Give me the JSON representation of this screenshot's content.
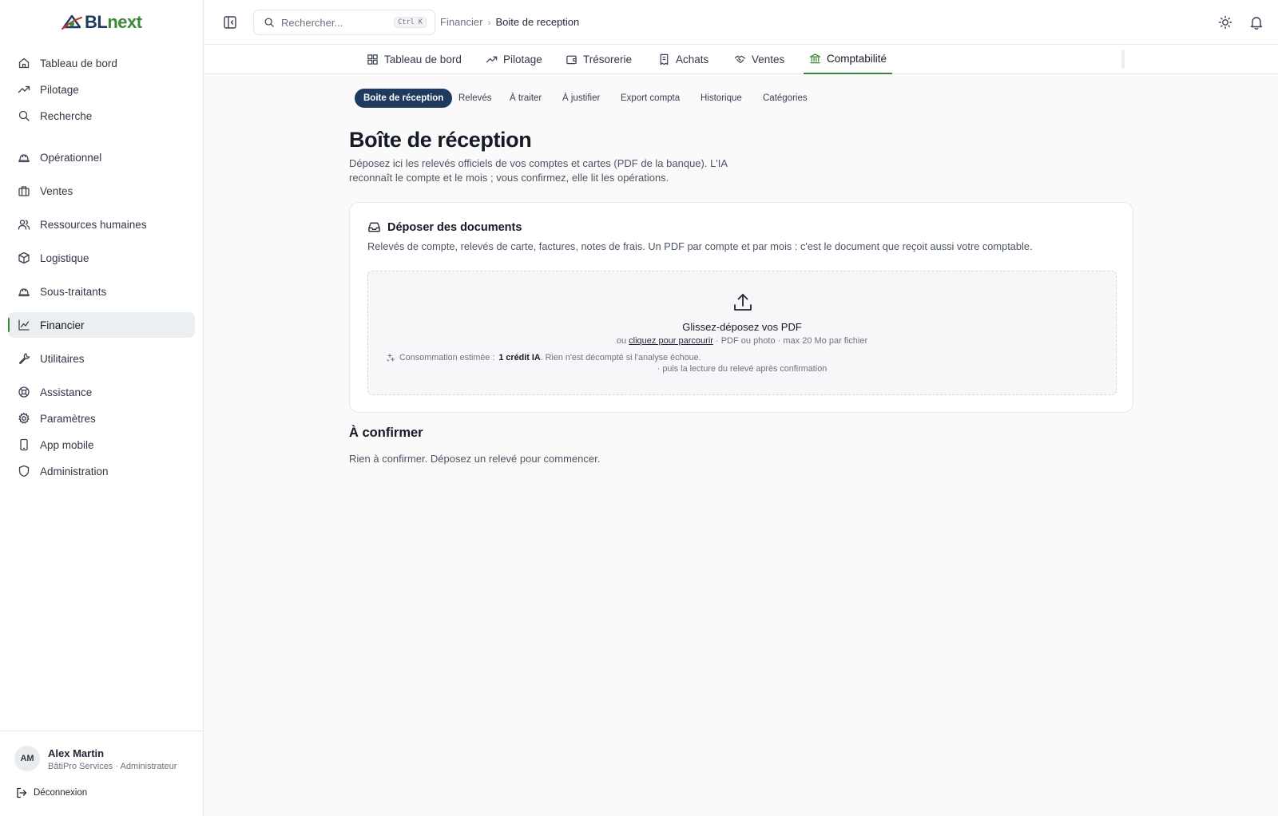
{
  "app": {
    "logo_prefix": "BL",
    "logo_suffix": "next",
    "colors": {
      "navy": "#1f3a5f",
      "green": "#3a8a3a"
    }
  },
  "sidebar": {
    "items": [
      {
        "label": "Tableau de bord",
        "icon": "home-icon"
      },
      {
        "label": "Pilotage",
        "icon": "trend-up-icon"
      },
      {
        "label": "Recherche",
        "icon": "search-icon"
      },
      {
        "label": "Opérationnel",
        "icon": "hard-hat-icon"
      },
      {
        "label": "Ventes",
        "icon": "briefcase-icon"
      },
      {
        "label": "Ressources humaines",
        "icon": "users-icon"
      },
      {
        "label": "Logistique",
        "icon": "box-icon"
      },
      {
        "label": "Sous-traitants",
        "icon": "hard-hat-icon"
      },
      {
        "label": "Financier",
        "icon": "chart-line-icon",
        "active": true
      },
      {
        "label": "Utilitaires",
        "icon": "wrench-icon"
      },
      {
        "label": "Assistance",
        "icon": "lifebuoy-icon"
      },
      {
        "label": "Paramètres",
        "icon": "gear-icon"
      },
      {
        "label": "App mobile",
        "icon": "phone-icon"
      },
      {
        "label": "Administration",
        "icon": "shield-icon"
      }
    ],
    "user": {
      "initials": "AM",
      "name": "Alex Martin",
      "role": "BâtiPro Services · Administrateur"
    },
    "logout_label": "Déconnexion"
  },
  "topbar": {
    "search_placeholder": "Rechercher...",
    "search_shortcut": "Ctrl K",
    "breadcrumb": [
      "Financier",
      "Boite de reception"
    ]
  },
  "module_tabs": [
    {
      "label": "Tableau de bord",
      "icon": "grid-icon"
    },
    {
      "label": "Pilotage",
      "icon": "trend-up-icon"
    },
    {
      "label": "Trésorerie",
      "icon": "wallet-icon"
    },
    {
      "label": "Achats",
      "icon": "receipt-icon"
    },
    {
      "label": "Ventes",
      "icon": "handshake-icon"
    },
    {
      "label": "Comptabilité",
      "icon": "bank-icon",
      "active": true
    }
  ],
  "sub_tabs": [
    {
      "label": "Boite de réception",
      "active": true
    },
    {
      "label": "Relevés"
    },
    {
      "label": "À traiter"
    },
    {
      "label": "À justifier"
    },
    {
      "label": "Export compta"
    },
    {
      "label": "Historique"
    },
    {
      "label": "Catégories"
    }
  ],
  "page": {
    "title": "Boîte de réception",
    "description": "Déposez ici les relevés officiels de vos comptes et cartes (PDF de la banque). L'IA reconnaît le compte et le mois ; vous confirmez, elle lit les opérations."
  },
  "upload_card": {
    "title": "Déposer des documents",
    "description": "Relevés de compte, relevés de carte, factures, notes de frais. Un PDF par compte et par mois : c'est le document que reçoit aussi votre comptable.",
    "drop_title": "Glissez-déposez vos PDF",
    "drop_prefix": "ou",
    "drop_link": "cliquez pour parcourir",
    "drop_suffix": "· PDF ou photo · max 20 Mo par fichier",
    "cost_prefix": "Consommation estimée :",
    "cost_value": "1 crédit IA",
    "cost_suffix": ". Rien n'est décompté si l'analyse échoue.",
    "cost_note": "· puis la lecture du relevé après confirmation"
  },
  "confirm_section": {
    "title": "À confirmer",
    "empty": "Rien à confirmer. Déposez un relevé pour commencer."
  }
}
